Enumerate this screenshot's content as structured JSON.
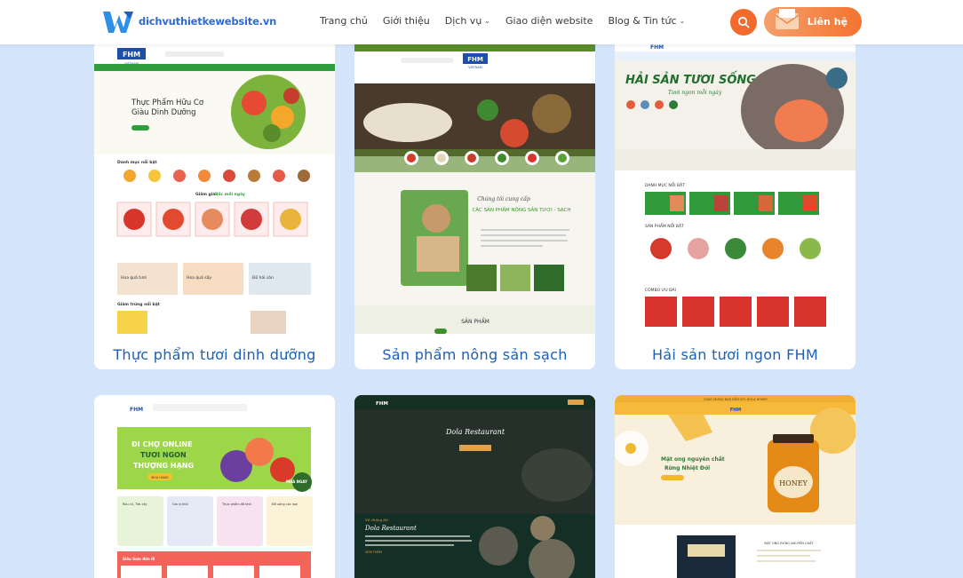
{
  "header": {
    "logo_text": "dichvuthietkewebsite.vn",
    "nav": [
      {
        "label": "Trang chủ",
        "dropdown": false
      },
      {
        "label": "Giới thiệu",
        "dropdown": false
      },
      {
        "label": "Dịch vụ",
        "dropdown": true
      },
      {
        "label": "Giao diện website",
        "dropdown": false
      },
      {
        "label": "Blog & Tin tức",
        "dropdown": true
      }
    ],
    "contact_label": "Liên hệ",
    "accent_color": "#f26a2d"
  },
  "cards": [
    {
      "title": "Thực phẩm tươi dinh dưỡng",
      "preview": {
        "brand": "FHM",
        "brand_sub": "VIETNAM",
        "hero_heading": "Thực Phẩm Hữu Cơ",
        "hero_heading_2": "Giàu Dinh Dưỡng",
        "section_1": "Danh mục nổi bật",
        "section_2": "Giảm giá",
        "section_2_highlight": "Bốc mỗi ngày",
        "promo_1": "Hoa quả tươi",
        "promo_2": "Hoa quả sấy",
        "promo_3": "Đồ hải sản",
        "section_3": "Giảm trứng nổi bật"
      }
    },
    {
      "title": "Sản phẩm nông sản sạch",
      "preview": {
        "brand": "FHM",
        "brand_sub": "VIETNAM",
        "script_heading": "Chúng tôi cung cấp",
        "heading": "CÁC SẢN PHẨM NÔNG SẢN TƯƠI - SẠCH",
        "section": "SẢN PHẨM"
      }
    },
    {
      "title": "Hải sản tươi ngon FHM",
      "preview": {
        "brand": "FHM",
        "hero_heading": "HẢI SẢN TƯƠI SỐNG",
        "hero_script": "Tươi ngon mỗi ngày",
        "section_1": "DANH MỤC NỔI BẬT",
        "section_2": "SẢN PHẨM NỔI BẬT",
        "section_3": "COMBO ƯU ĐÃI"
      }
    },
    {
      "title": "",
      "preview": {
        "brand": "FHM",
        "hero_heading_1": "ĐI CHỢ ONLINE",
        "hero_heading_2": "TƯƠI NGON",
        "hero_heading_3": "THƯỢNG HẠNG",
        "hero_button": "MUA HÀNG",
        "badge": "MUA NGAY",
        "cat_1": "Rau củ, Trái cây",
        "cat_2": "Gia vị khô",
        "cat_3": "Thực phẩm đồ khô",
        "cat_4": "Đồ uống các loại",
        "section": "Siêu Sale đón lễ"
      }
    },
    {
      "title": "",
      "preview": {
        "brand": "FHM",
        "hero_script": "Dola Restaurant",
        "about_label": "Về chúng tôi",
        "about_script": "Dola Restaurant",
        "button": "XEM THÊM"
      }
    },
    {
      "title": "",
      "preview": {
        "brand": "FHM",
        "topbar": "CHÀO MỪNG BẠN ĐẾN VỚI DOLA HONEY",
        "hero_heading_1": "Mật ong nguyên chất",
        "hero_heading_2": "Rừng Nhiệt Đới",
        "jar_label": "HONEY",
        "section": "MẬT ONG RỪNG NGUYÊN CHẤT"
      }
    }
  ]
}
